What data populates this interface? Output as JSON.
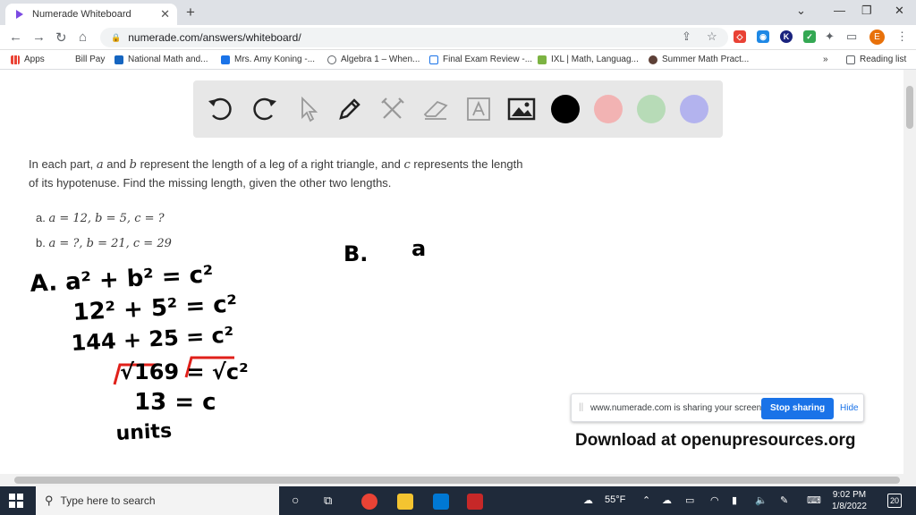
{
  "browser": {
    "tab_title": "Numerade Whiteboard",
    "url": "numerade.com/answers/whiteboard/",
    "profile_initial": "E"
  },
  "bookmarks": [
    "Apps",
    "Bill Pay",
    "National Math and...",
    "Mrs. Amy Koning -...",
    "Algebra 1 – When...",
    "Final Exam Review -...",
    "IXL | Math, Languag...",
    "Summer Math Pract...",
    "Reading list"
  ],
  "toolbar": {
    "tools": [
      "undo-icon",
      "redo-icon",
      "pointer-icon",
      "pen-icon",
      "tools-icon",
      "eraser-icon",
      "text-icon",
      "image-icon"
    ],
    "colors": [
      "#000000",
      "#f2b3b3",
      "#b7dbb7",
      "#b3b3ee"
    ]
  },
  "problem": {
    "intro_1": "In each part,",
    "var_a": "a",
    "and": "and",
    "var_b": "b",
    "intro_2": "represent the length of a leg of a right triangle, and",
    "var_c": "c",
    "intro_3": "represents the length of its hypotenuse. Find the missing length, given the other two lengths.",
    "part_a_label": "a.",
    "part_a": "a = 12, b = 5, c = ?",
    "part_b_label": "b.",
    "part_b": "a = ?, b = 21, c = 29"
  },
  "handwriting": {
    "line1": "A. a² + b² = c²",
    "line2": "12² + 5² = c²",
    "line3": "144 + 25 = c²",
    "line4": "√169 = √c²",
    "line5": "13 = c",
    "line6": "units",
    "b_label": "B.",
    "b_start": "a"
  },
  "share_bar": {
    "message": "www.numerade.com is sharing your screen.",
    "stop_label": "Stop sharing",
    "hide_label": "Hide"
  },
  "watermark": "Download at openupresources.org",
  "taskbar": {
    "search_placeholder": "Type here to search",
    "weather": "55°F",
    "time": "9:02 PM",
    "date": "1/8/2022",
    "notifications": "20"
  }
}
